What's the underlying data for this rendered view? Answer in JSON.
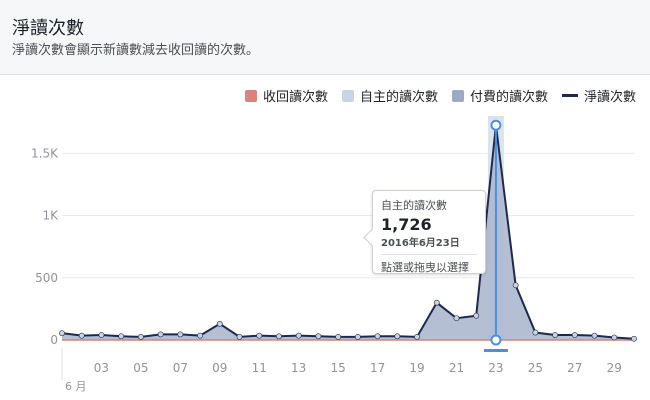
{
  "header": {
    "title": "淨讀次數",
    "subtitle": "淨讀次數會顯示新讀數減去收回讀的次數。"
  },
  "legend": [
    {
      "label": "收回讀次數",
      "color": "#d9837a",
      "kind": "box"
    },
    {
      "label": "自主的讀次數",
      "color": "#c9d3e3",
      "kind": "box"
    },
    {
      "label": "付費的讀次數",
      "color": "#9daac4",
      "kind": "box"
    },
    {
      "label": "淨讀次數",
      "color": "#1d2a4d",
      "kind": "line"
    }
  ],
  "tooltip": {
    "series": "自主的讀次數",
    "value": "1,726",
    "date": "2016年6月23日",
    "hint": "點選或拖曳以選擇"
  },
  "chart_data": {
    "type": "area",
    "x": [
      1,
      2,
      3,
      4,
      5,
      6,
      7,
      8,
      9,
      10,
      11,
      12,
      13,
      14,
      15,
      16,
      17,
      18,
      19,
      20,
      21,
      22,
      23,
      24,
      25,
      26,
      27,
      28,
      29,
      30
    ],
    "x_tick_labels": [
      "03",
      "05",
      "07",
      "09",
      "11",
      "13",
      "15",
      "17",
      "19",
      "21",
      "23",
      "25",
      "27",
      "29"
    ],
    "x_month_label": "6 月",
    "y_tick_labels": [
      "0",
      "500",
      "1K",
      "1.5K"
    ],
    "ylim": [
      0,
      1800
    ],
    "grid": true,
    "legend_position": "top-right",
    "highlight_x": 23,
    "series": [
      {
        "name": "收回讀次數",
        "color": "#d9837a",
        "values": [
          0,
          0,
          0,
          0,
          0,
          0,
          0,
          0,
          0,
          0,
          0,
          0,
          0,
          0,
          0,
          0,
          0,
          0,
          0,
          0,
          0,
          0,
          0,
          0,
          0,
          0,
          0,
          0,
          0,
          0
        ]
      },
      {
        "name": "自主的讀次數",
        "color": "#c9d3e3",
        "values": [
          55,
          35,
          40,
          30,
          25,
          45,
          45,
          35,
          130,
          25,
          35,
          30,
          35,
          30,
          25,
          25,
          30,
          30,
          25,
          300,
          175,
          195,
          1726,
          440,
          60,
          40,
          40,
          35,
          20,
          10
        ]
      },
      {
        "name": "付費的讀次數",
        "color": "#9daac4",
        "values": [
          55,
          35,
          40,
          30,
          25,
          45,
          45,
          35,
          130,
          25,
          35,
          30,
          35,
          30,
          25,
          25,
          30,
          30,
          25,
          300,
          175,
          195,
          1726,
          440,
          60,
          40,
          40,
          35,
          20,
          10
        ]
      },
      {
        "name": "淨讀次數",
        "color": "#1d2a4d",
        "values": [
          55,
          35,
          40,
          30,
          25,
          45,
          45,
          35,
          130,
          25,
          35,
          30,
          35,
          30,
          25,
          25,
          30,
          30,
          25,
          300,
          175,
          195,
          1726,
          440,
          60,
          40,
          40,
          35,
          20,
          10
        ]
      }
    ]
  }
}
